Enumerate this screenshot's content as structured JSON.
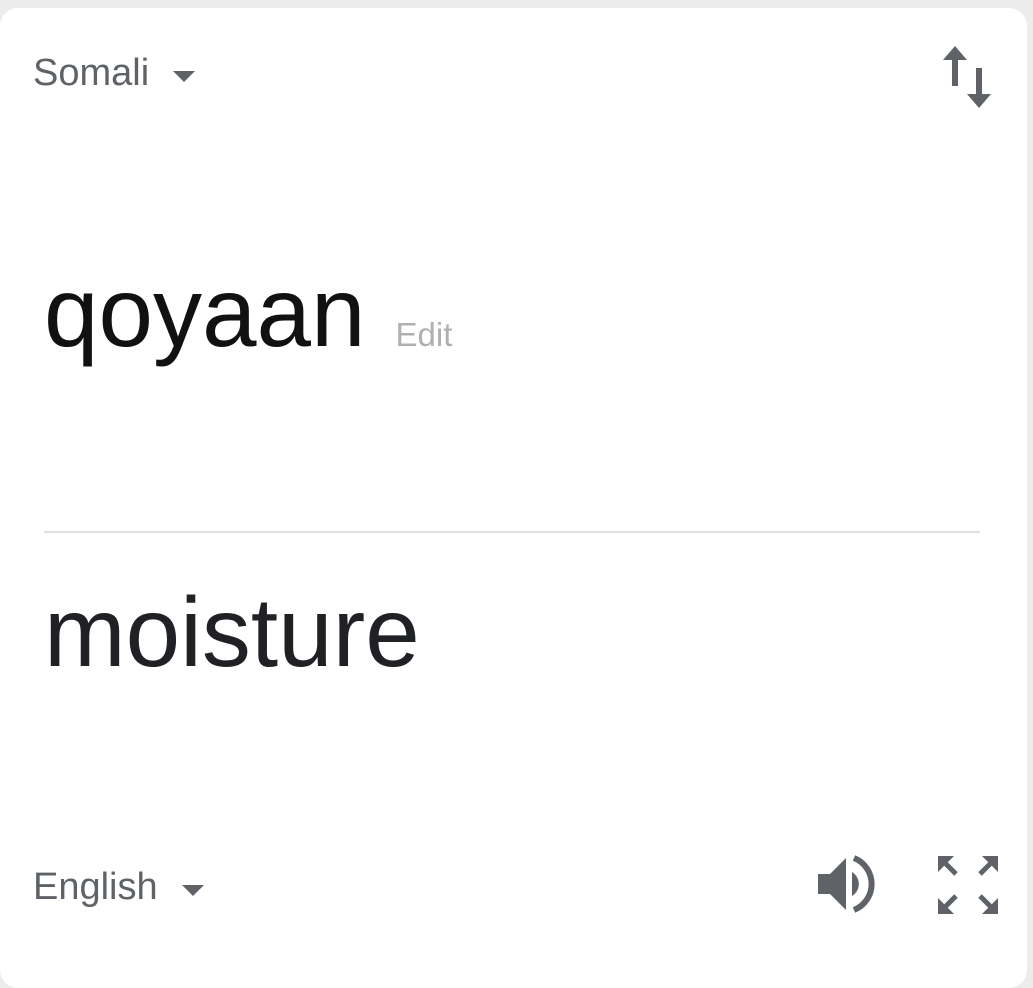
{
  "source": {
    "language": "Somali",
    "text": "qoyaan",
    "edit_label": "Edit"
  },
  "target": {
    "language": "English",
    "text": "moisture"
  },
  "icons": {
    "swap": "swap-languages-icon",
    "speaker": "speaker-icon",
    "fullscreen": "fullscreen-icon",
    "dropdown": "caret-down-icon"
  },
  "colors": {
    "icon_gray": "#5f6368",
    "edit_gray": "#b0b0b0",
    "text_primary": "#111111"
  }
}
